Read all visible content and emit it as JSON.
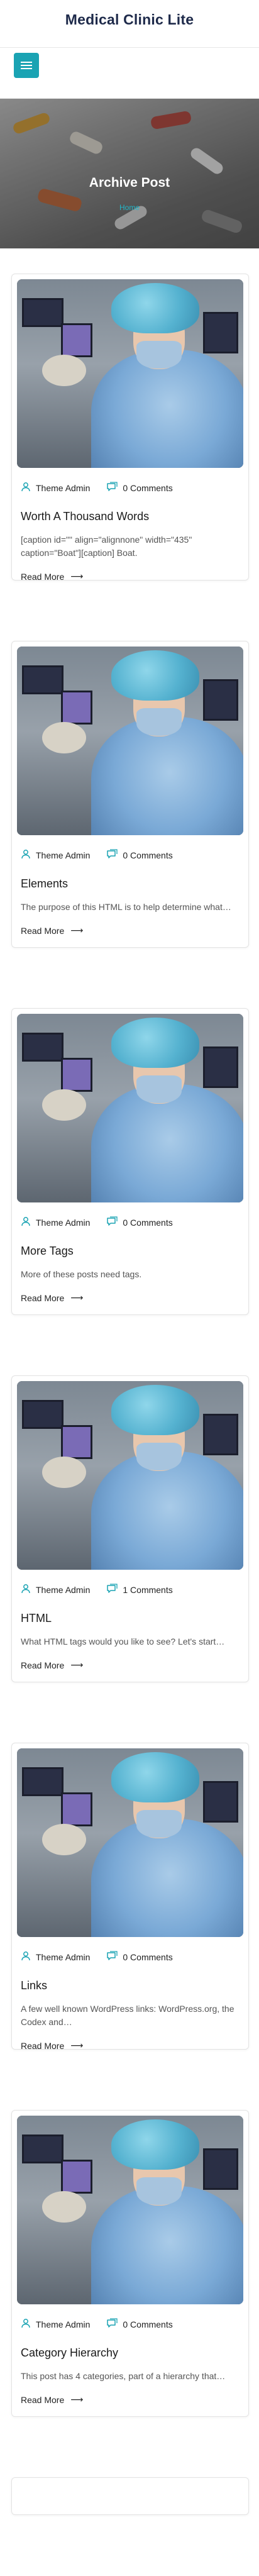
{
  "site": {
    "title": "Medical Clinic Lite"
  },
  "banner": {
    "title": "Archive Post",
    "crumb": "Home"
  },
  "posts": [
    {
      "author": "Theme Admin",
      "comments": "0 Comments",
      "title": "Worth A Thousand Words",
      "excerpt": "[caption id=\"\" align=\"alignnone\" width=\"435\" caption=\"Boat\"][caption] Boat.",
      "read_more": "Read More"
    },
    {
      "author": "Theme Admin",
      "comments": "0 Comments",
      "title": "Elements",
      "excerpt": "The purpose of this HTML is to help determine what…",
      "read_more": "Read More"
    },
    {
      "author": "Theme Admin",
      "comments": "0 Comments",
      "title": "More Tags",
      "excerpt": "More of these posts need tags.",
      "read_more": "Read More"
    },
    {
      "author": "Theme Admin",
      "comments": "1 Comments",
      "title": "HTML",
      "excerpt": "What HTML tags would you like to see? Let's start…",
      "read_more": "Read More"
    },
    {
      "author": "Theme Admin",
      "comments": "0 Comments",
      "title": "Links",
      "excerpt": "A few well known WordPress links: WordPress.org, the Codex and…",
      "read_more": "Read More"
    },
    {
      "author": "Theme Admin",
      "comments": "0 Comments",
      "title": "Category Hierarchy",
      "excerpt": "This post has 4 categories, part of a hierarchy that…",
      "read_more": "Read More"
    }
  ],
  "colors": {
    "accent": "#1aa3b3",
    "title": "#1e2a4a"
  },
  "icons": {
    "author": "user-icon",
    "comments": "comment-icon",
    "read_more": "arrow-right-icon",
    "menu": "hamburger-icon"
  }
}
